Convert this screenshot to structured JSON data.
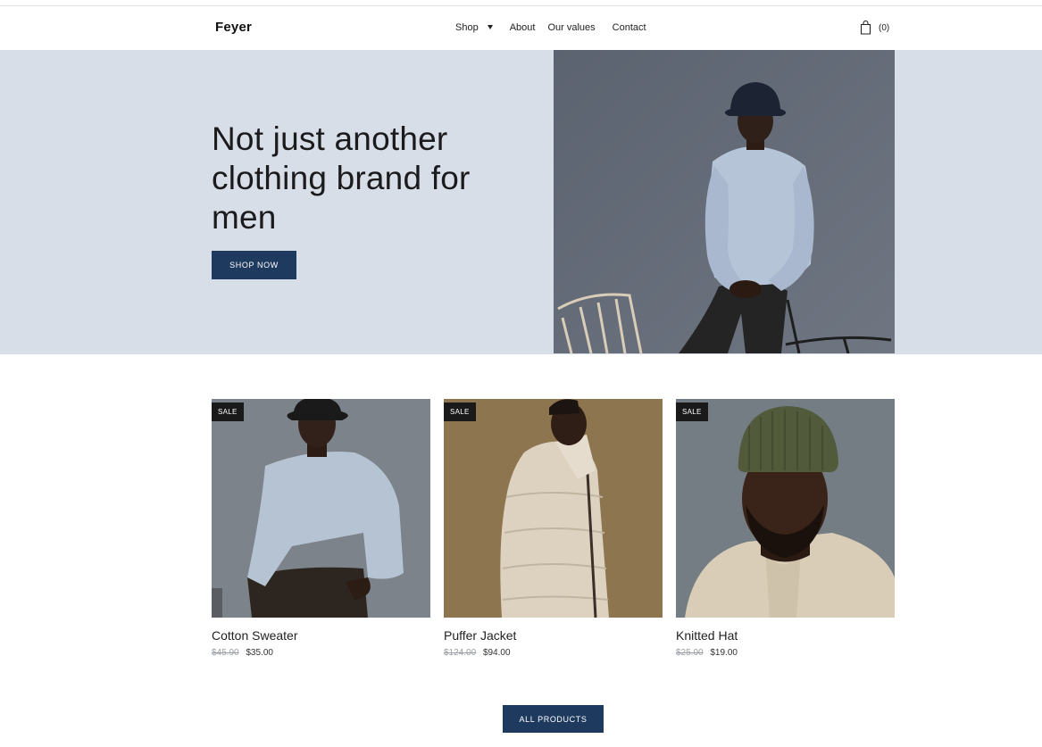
{
  "header": {
    "logo": "Feyer",
    "nav": {
      "shop": "Shop",
      "about": "About",
      "values": "Our values",
      "contact": "Contact"
    },
    "cart_count": "(0)"
  },
  "hero": {
    "title": "Not just another clothing brand for men",
    "button": "SHOP NOW"
  },
  "products": [
    {
      "badge": "SALE",
      "name": "Cotton Sweater",
      "old_price": "$45.90",
      "price": "$35.00"
    },
    {
      "badge": "SALE",
      "name": "Puffer Jacket",
      "old_price": "$124.00",
      "price": "$94.00"
    },
    {
      "badge": "SALE",
      "name": "Knitted Hat",
      "old_price": "$25.00",
      "price": "$19.00"
    }
  ],
  "all_products_button": "ALL PRODUCTS",
  "colors": {
    "hero_bg": "#d7dee7",
    "button_bg": "#1f3a5f",
    "badge_bg": "#1a1a1a"
  },
  "icons": {
    "cart": "shopping-bag-icon",
    "dropdown": "caret-down-icon"
  }
}
